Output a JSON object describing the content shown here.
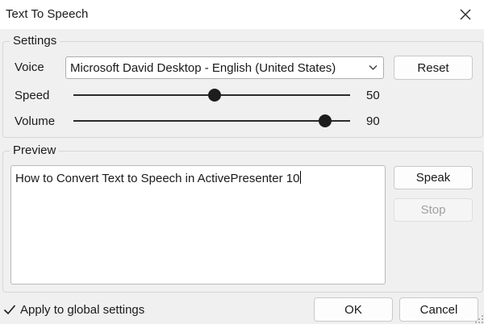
{
  "window": {
    "title": "Text To Speech"
  },
  "settings": {
    "legend": "Settings",
    "voice_label": "Voice",
    "voice_value": "Microsoft David Desktop - English (United States)",
    "reset_label": "Reset",
    "speed_label": "Speed",
    "speed_value": "50",
    "speed_fraction": 0.5,
    "volume_label": "Volume",
    "volume_value": "90",
    "volume_fraction": 0.9
  },
  "preview": {
    "legend": "Preview",
    "text": "How to Convert Text to Speech in ActivePresenter 10",
    "speak_label": "Speak",
    "stop_label": "Stop"
  },
  "footer": {
    "apply_label": "Apply to global settings",
    "apply_checked": true,
    "ok_label": "OK",
    "cancel_label": "Cancel"
  },
  "icons": {
    "close": "close-icon",
    "dropdown": "chevron-down-icon",
    "check": "checkmark-icon",
    "grip": "resize-grip-icon"
  }
}
